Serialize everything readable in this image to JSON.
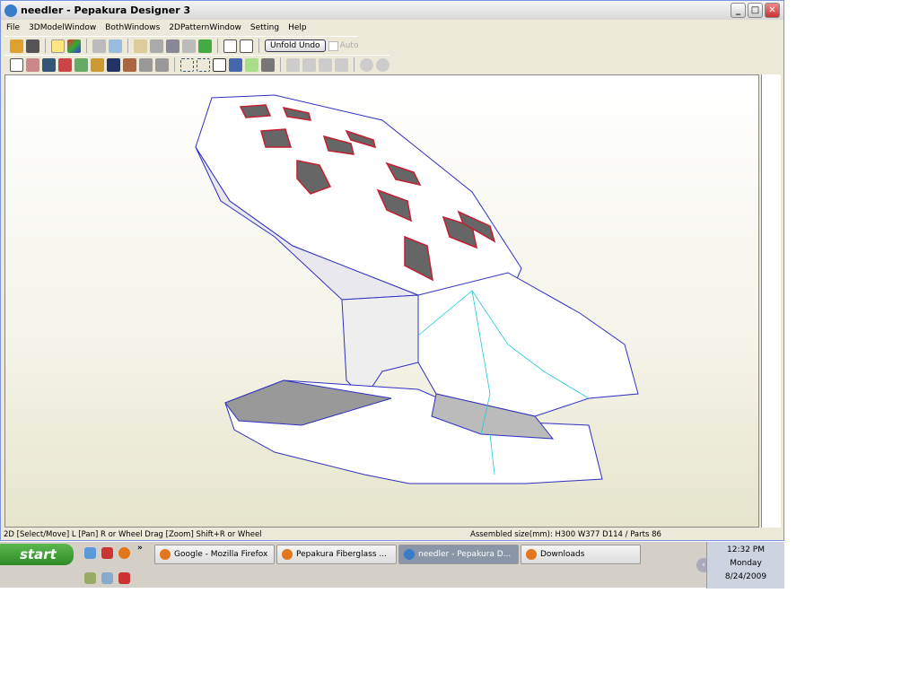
{
  "window": {
    "title": "needler - Pepakura Designer 3"
  },
  "menu": [
    "File",
    "3DModelWindow",
    "BothWindows",
    "2DPatternWindow",
    "Setting",
    "Help"
  ],
  "toolbar": {
    "unfold_undo": "Unfold Undo",
    "auto": "Auto"
  },
  "status": {
    "left": "2D [Select/Move] L [Pan] R or Wheel Drag [Zoom] Shift+R or Wheel",
    "right": "Assembled size(mm): H300 W377 D114 / Parts 86"
  },
  "taskbar": {
    "start": "start",
    "more": "»",
    "tasks": [
      {
        "label": "Google - Mozilla Firefox",
        "active": false
      },
      {
        "label": "Pepakura Fiberglass ...",
        "active": false
      },
      {
        "label": "needler - Pepakura D...",
        "active": true
      },
      {
        "label": "Downloads",
        "active": false
      }
    ],
    "clock": {
      "time": "12:32 PM",
      "day": "Monday",
      "date": "8/24/2009"
    }
  },
  "colors": {
    "edge": "#3030c0",
    "fold": "#20c8e0",
    "cutout": "#c02030"
  }
}
